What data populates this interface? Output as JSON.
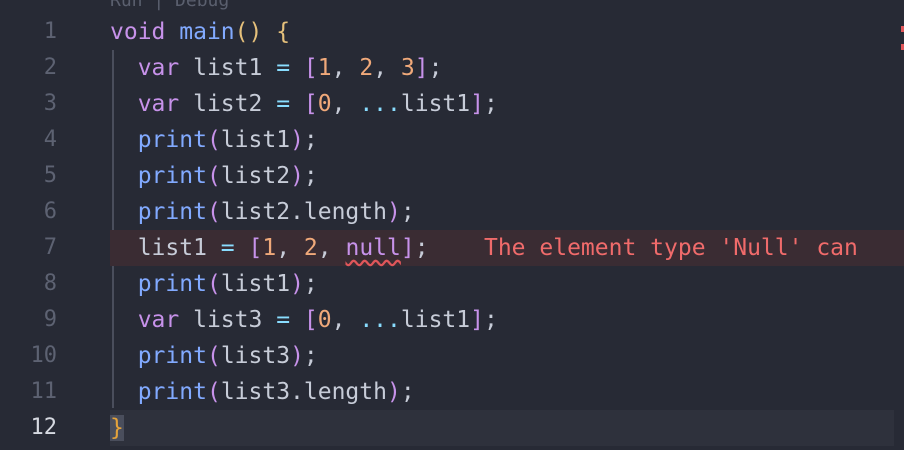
{
  "codelens": "Run | Debug",
  "lines": [
    {
      "n": "1",
      "tokens": [
        [
          "kw",
          "void"
        ],
        [
          "var",
          " "
        ],
        [
          "fn",
          "main"
        ],
        [
          "paren-y",
          "()"
        ],
        [
          "var",
          " "
        ],
        [
          "brace-y",
          "{"
        ]
      ]
    },
    {
      "n": "2",
      "tokens": [
        [
          "var",
          "  "
        ],
        [
          "kw",
          "var"
        ],
        [
          "var",
          " list1 "
        ],
        [
          "op",
          "="
        ],
        [
          "var",
          " "
        ],
        [
          "bracket",
          "["
        ],
        [
          "num",
          "1"
        ],
        [
          "punc",
          ", "
        ],
        [
          "num",
          "2"
        ],
        [
          "punc",
          ", "
        ],
        [
          "num",
          "3"
        ],
        [
          "bracket",
          "]"
        ],
        [
          "punc",
          ";"
        ]
      ]
    },
    {
      "n": "3",
      "tokens": [
        [
          "var",
          "  "
        ],
        [
          "kw",
          "var"
        ],
        [
          "var",
          " list2 "
        ],
        [
          "op",
          "="
        ],
        [
          "var",
          " "
        ],
        [
          "bracket",
          "["
        ],
        [
          "num",
          "0"
        ],
        [
          "punc",
          ", "
        ],
        [
          "op",
          "..."
        ],
        [
          "var",
          "list1"
        ],
        [
          "bracket",
          "]"
        ],
        [
          "punc",
          ";"
        ]
      ]
    },
    {
      "n": "4",
      "tokens": [
        [
          "var",
          "  "
        ],
        [
          "fn",
          "print"
        ],
        [
          "bracket",
          "("
        ],
        [
          "var",
          "list1"
        ],
        [
          "bracket",
          ")"
        ],
        [
          "punc",
          ";"
        ]
      ]
    },
    {
      "n": "5",
      "tokens": [
        [
          "var",
          "  "
        ],
        [
          "fn",
          "print"
        ],
        [
          "bracket",
          "("
        ],
        [
          "var",
          "list2"
        ],
        [
          "bracket",
          ")"
        ],
        [
          "punc",
          ";"
        ]
      ]
    },
    {
      "n": "6",
      "tokens": [
        [
          "var",
          "  "
        ],
        [
          "fn",
          "print"
        ],
        [
          "bracket",
          "("
        ],
        [
          "var",
          "list2.length"
        ],
        [
          "bracket",
          ")"
        ],
        [
          "punc",
          ";"
        ]
      ]
    },
    {
      "n": "7",
      "tokens": [
        [
          "var",
          "  list1 "
        ],
        [
          "op",
          "="
        ],
        [
          "var",
          " "
        ],
        [
          "bracket",
          "["
        ],
        [
          "num",
          "1"
        ],
        [
          "punc",
          ", "
        ],
        [
          "num",
          "2"
        ],
        [
          "punc",
          ", "
        ],
        [
          "nul",
          "null"
        ],
        [
          "bracket",
          "]"
        ],
        [
          "punc",
          ";"
        ],
        [
          "var",
          "    "
        ],
        [
          "err-msg",
          "The element type 'Null' can"
        ]
      ]
    },
    {
      "n": "8",
      "tokens": [
        [
          "var",
          "  "
        ],
        [
          "fn",
          "print"
        ],
        [
          "bracket",
          "("
        ],
        [
          "var",
          "list1"
        ],
        [
          "bracket",
          ")"
        ],
        [
          "punc",
          ";"
        ]
      ]
    },
    {
      "n": "9",
      "tokens": [
        [
          "var",
          "  "
        ],
        [
          "kw",
          "var"
        ],
        [
          "var",
          " list3 "
        ],
        [
          "op",
          "="
        ],
        [
          "var",
          " "
        ],
        [
          "bracket",
          "["
        ],
        [
          "num",
          "0"
        ],
        [
          "punc",
          ", "
        ],
        [
          "op",
          "..."
        ],
        [
          "var",
          "list1"
        ],
        [
          "bracket",
          "]"
        ],
        [
          "punc",
          ";"
        ]
      ]
    },
    {
      "n": "10",
      "tokens": [
        [
          "var",
          "  "
        ],
        [
          "fn",
          "print"
        ],
        [
          "bracket",
          "("
        ],
        [
          "var",
          "list3"
        ],
        [
          "bracket",
          ")"
        ],
        [
          "punc",
          ";"
        ]
      ]
    },
    {
      "n": "11",
      "tokens": [
        [
          "var",
          "  "
        ],
        [
          "fn",
          "print"
        ],
        [
          "bracket",
          "("
        ],
        [
          "var",
          "list3.length"
        ],
        [
          "bracket",
          ")"
        ],
        [
          "punc",
          ";"
        ]
      ]
    },
    {
      "n": "12",
      "tokens": [
        [
          "brace-box",
          "}"
        ]
      ]
    }
  ],
  "active_line": "12",
  "error_line": "7",
  "colors": {
    "background": "#272a35",
    "keyword": "#c792ea",
    "function": "#82aaff",
    "number": "#f0a97a",
    "error": "#f06b6b"
  }
}
